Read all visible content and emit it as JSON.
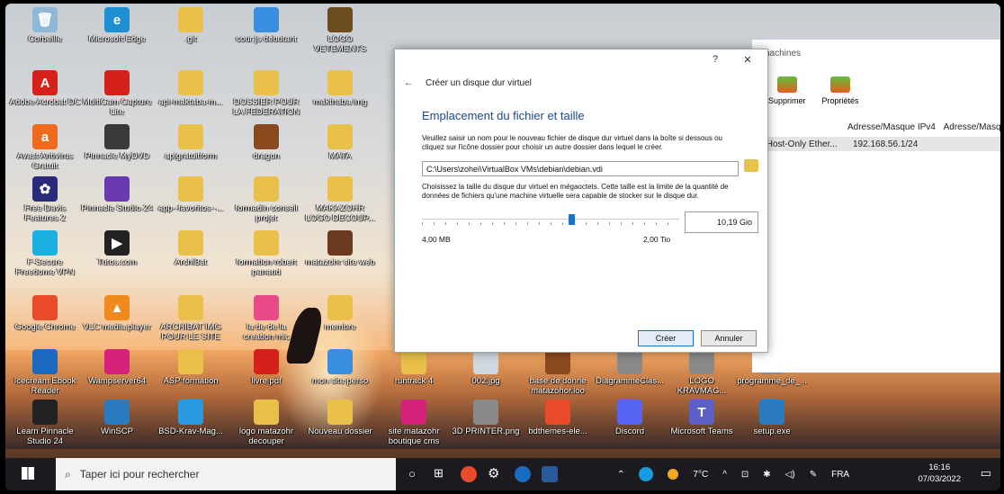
{
  "desktop": {
    "icons": [
      {
        "label": "Corbeille",
        "color": "#8fb8d8",
        "glyph": "🗑"
      },
      {
        "label": "Microsoft Edge",
        "color": "#1d8fd2",
        "glyph": "e"
      },
      {
        "label": ".git",
        "color": "#e8c04a",
        "glyph": ""
      },
      {
        "label": "cour js debutant",
        "color": "#3a8ee0",
        "glyph": ""
      },
      {
        "label": "LOGO VETEMENTS",
        "color": "#6b4c1e",
        "glyph": ""
      },
      {
        "label": "Adobe Acrobat DC",
        "color": "#d6211a",
        "glyph": "A"
      },
      {
        "label": "MultiCam Capture Lite",
        "color": "#d6211a",
        "glyph": ""
      },
      {
        "label": "api-maktaba-m...",
        "color": "#e8c04a",
        "glyph": ""
      },
      {
        "label": "DOSSIER POUR LA FEDERATION",
        "color": "#e8c04a",
        "glyph": ""
      },
      {
        "label": "makthaba img",
        "color": "#e8c04a",
        "glyph": ""
      },
      {
        "label": "Avast Antivirus Gratuit",
        "color": "#f06a1c",
        "glyph": "a"
      },
      {
        "label": "Pinnacle MyDVD",
        "color": "#3a3a3a",
        "glyph": ""
      },
      {
        "label": "apigratuitform",
        "color": "#e8c04a",
        "glyph": ""
      },
      {
        "label": "dragon",
        "color": "#8a4a1e",
        "glyph": ""
      },
      {
        "label": "MATA",
        "color": "#e8c04a",
        "glyph": ""
      },
      {
        "label": "Free Davis Features 2",
        "color": "#2a2a7a",
        "glyph": "✿"
      },
      {
        "label": "Pinnacle Studio 24",
        "color": "#6a3ab0",
        "glyph": ""
      },
      {
        "label": "app--favoritos--...",
        "color": "#e8c04a",
        "glyph": ""
      },
      {
        "label": "formadin conseil projet",
        "color": "#e8c04a",
        "glyph": ""
      },
      {
        "label": "MAKAZOHR LOGO DECOUP...",
        "color": "#e8c04a",
        "glyph": ""
      },
      {
        "label": "F-Secure Freedome VPN",
        "color": "#1ab0e0",
        "glyph": ""
      },
      {
        "label": "Tutos.com",
        "color": "#222",
        "glyph": "▶"
      },
      {
        "label": "ArchiBat",
        "color": "#e8c04a",
        "glyph": ""
      },
      {
        "label": "formation robert panaud",
        "color": "#e8c04a",
        "glyph": ""
      },
      {
        "label": "matazohr site web",
        "color": "#6b3a1e",
        "glyph": ""
      },
      {
        "label": "Google Chrome",
        "color": "#e84a2a",
        "glyph": ""
      },
      {
        "label": "VLC media player",
        "color": "#f08a1c",
        "glyph": "▲"
      },
      {
        "label": "ARCHIBAT IMG POUR LE SITE",
        "color": "#e8c04a",
        "glyph": ""
      },
      {
        "label": "la de de la creation mic",
        "color": "#e84a8a",
        "glyph": ""
      },
      {
        "label": "membre",
        "color": "#e8c04a",
        "glyph": ""
      },
      {
        "label": "Icecream Ebook Reader",
        "color": "#1a6ac0",
        "glyph": ""
      },
      {
        "label": "Wampserver64",
        "color": "#d6217a",
        "glyph": ""
      },
      {
        "label": "ASP formation",
        "color": "#e8c04a",
        "glyph": ""
      },
      {
        "label": "livre pdf",
        "color": "#d6211a",
        "glyph": ""
      },
      {
        "label": "mon site perso",
        "color": "#3a8ee0",
        "glyph": ""
      },
      {
        "label": "runtrack 4",
        "color": "#e8c04a",
        "glyph": ""
      },
      {
        "label": "002.jpg",
        "color": "#cfd8e0",
        "glyph": ""
      },
      {
        "label": "base de donne matazohor.loo",
        "color": "#8a4a1e",
        "glyph": ""
      },
      {
        "label": "DiagrammeClas...",
        "color": "#8a8a8a",
        "glyph": ""
      },
      {
        "label": "LOGO KRAVMAG...",
        "color": "#8a8a8a",
        "glyph": ""
      },
      {
        "label": "programme_de_...",
        "color": "#8a8a8a",
        "glyph": ""
      },
      {
        "label": "Learn Pinnacle Studio 24",
        "color": "#222",
        "glyph": ""
      },
      {
        "label": "WinSCP",
        "color": "#2a7ac0",
        "glyph": ""
      },
      {
        "label": "BSD-Krav-Mag...",
        "color": "#2a9ae0",
        "glyph": ""
      },
      {
        "label": "logo matazohr decouper",
        "color": "#e8c04a",
        "glyph": ""
      },
      {
        "label": "Nouveau dossier",
        "color": "#e8c04a",
        "glyph": ""
      },
      {
        "label": "site matazohr boutique cms",
        "color": "#d6217a",
        "glyph": ""
      },
      {
        "label": "3D PRINTER.png",
        "color": "#8a8a8a",
        "glyph": ""
      },
      {
        "label": "bdthemes-ele...",
        "color": "#e84a2a",
        "glyph": ""
      },
      {
        "label": "Discord",
        "color": "#5865f2",
        "glyph": ""
      },
      {
        "label": "Microsoft Teams",
        "color": "#5b5fc7",
        "glyph": "T"
      },
      {
        "label": "setup.exe",
        "color": "#2a7ac0",
        "glyph": ""
      }
    ]
  },
  "vbox": {
    "header": "nachines",
    "toolbar": [
      {
        "label": "Supprimer"
      },
      {
        "label": "Propriétés"
      }
    ],
    "col_ipv4": "Adresse/Masque IPv4",
    "col_ipv6": "Adresse/Masq",
    "row_name": "x Host-Only Ether...",
    "row_ip": "192.168.56.1/24"
  },
  "dialog": {
    "help": "?",
    "close": "✕",
    "back": "←",
    "crumb": "Créer un disque dur virtuel",
    "heading": "Emplacement du fichier et taille",
    "desc1": "Veuillez saisir un nom pour le nouveau fichier de disque dur virtuel dans la boîte si dessous ou cliquez sur l'icône dossier pour choisir un autre dossier dans lequel le créer.",
    "path": "C:\\Users\\zohei\\VirtualBox VMs\\debian\\debian.vdi",
    "desc2": "Choisissez la taille du disque dur virtuel en mégaoctets. Cette taille est la limite de la quantité de données de fichiers qu'une machine virtuelle sera capable de stocker sur le disque dur.",
    "size_value": "10,19 Gio",
    "slider_fraction": 0.58,
    "min_label": "4,00 MB",
    "max_label": "2,00 Tio",
    "create": "Créer",
    "cancel": "Annuler"
  },
  "taskbar": {
    "search_placeholder": "Taper ici pour rechercher",
    "weather": "7°C",
    "language": "FRA",
    "time": "16:16",
    "date": "07/03/2022"
  }
}
